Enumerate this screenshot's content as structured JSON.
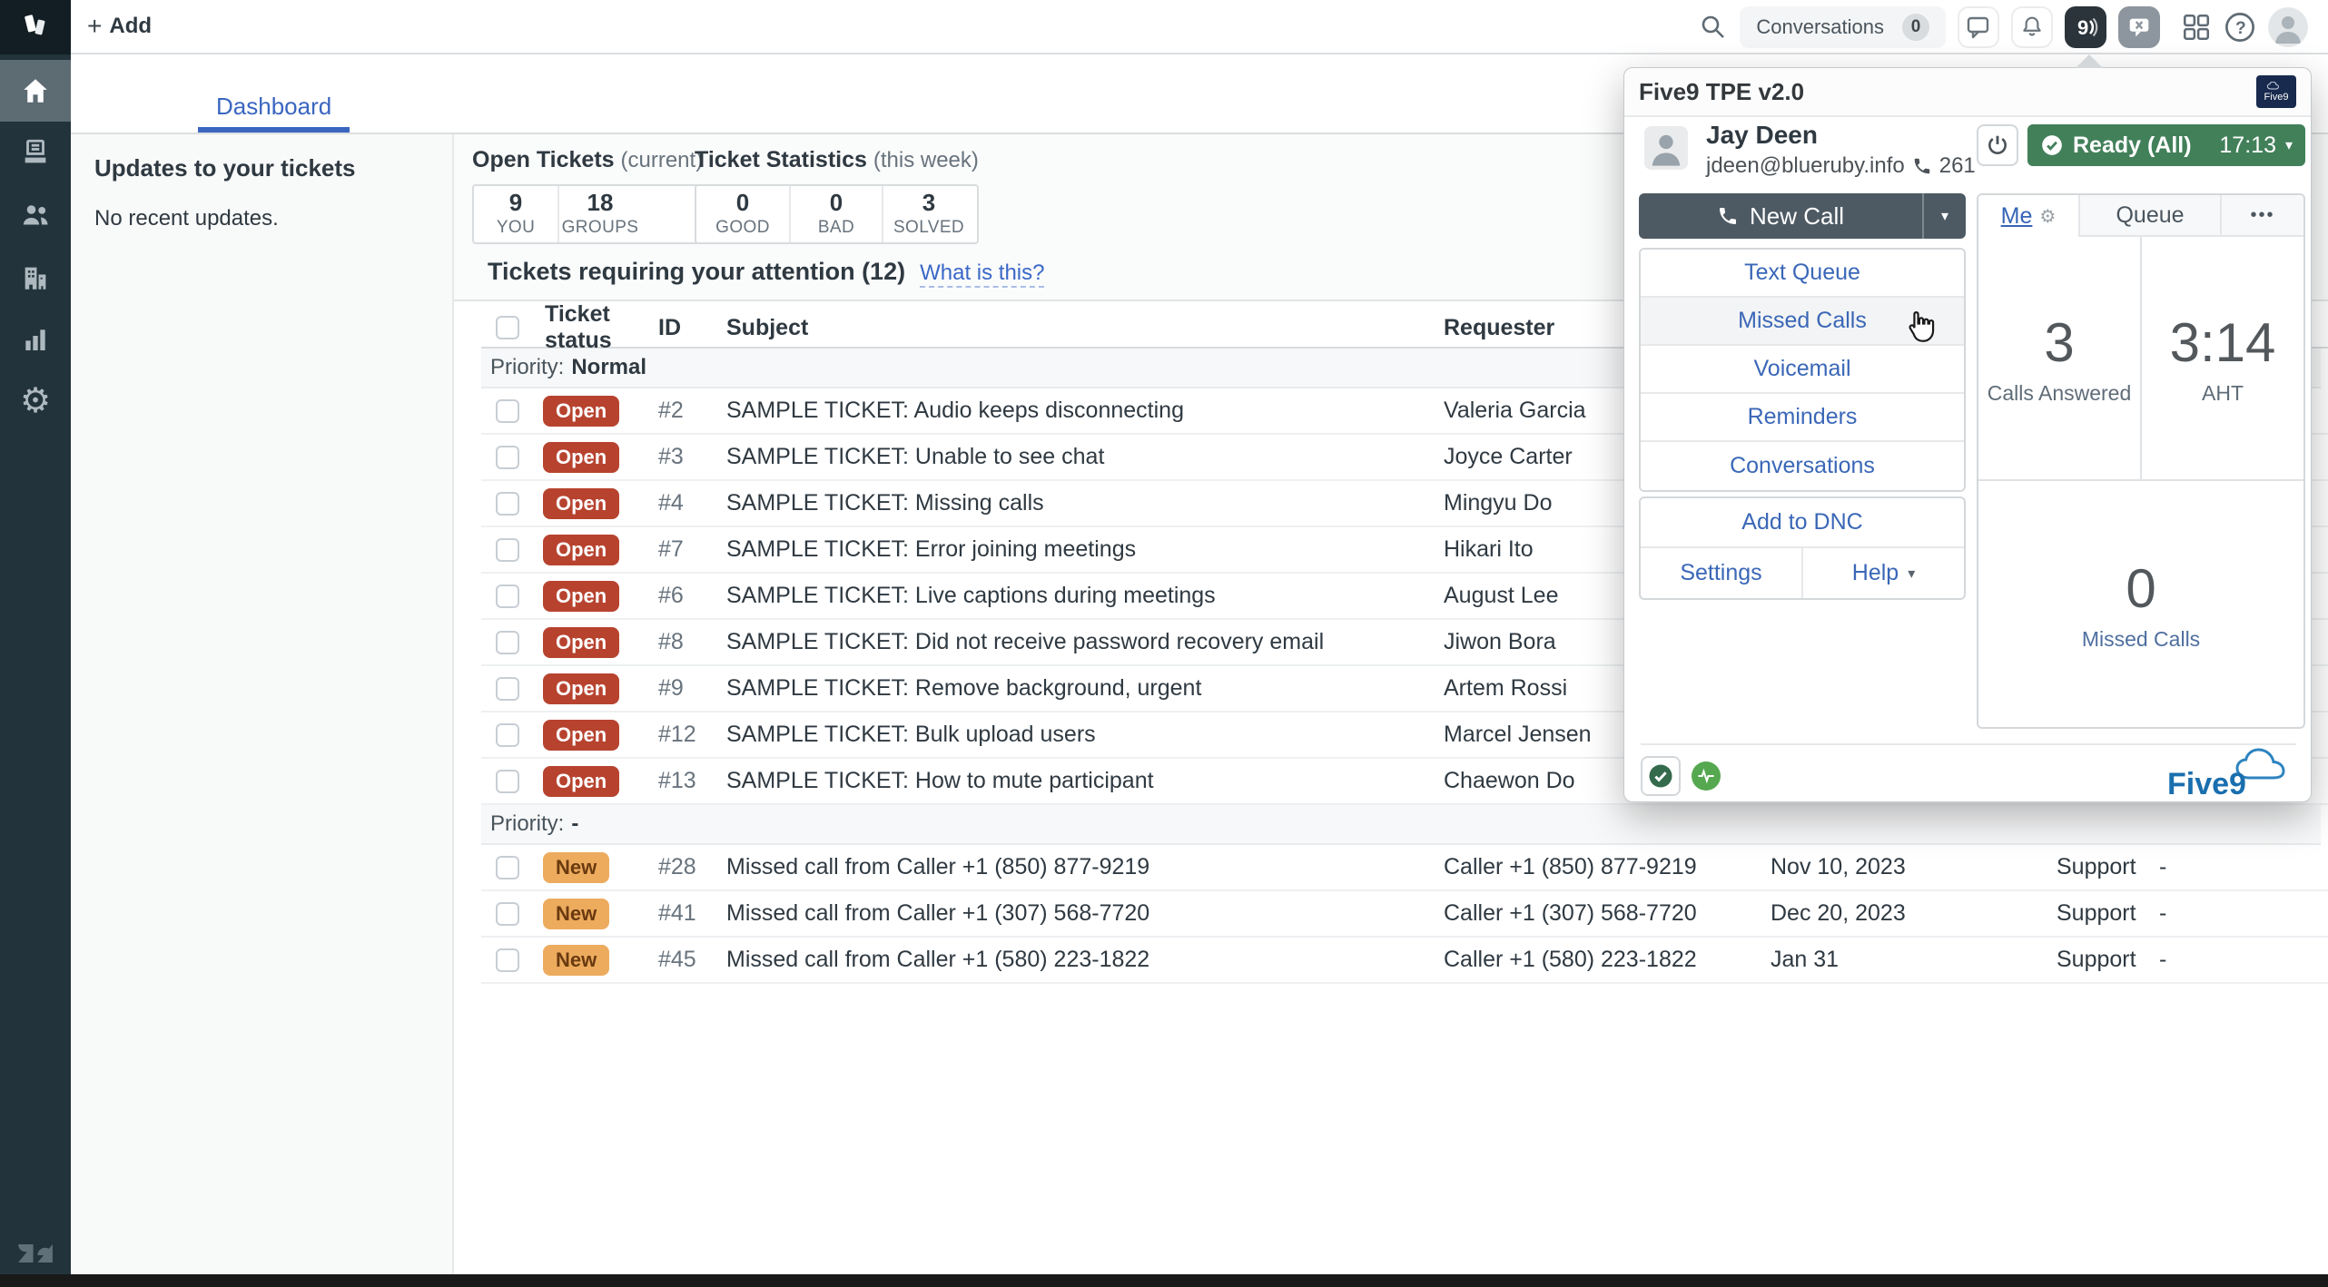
{
  "topnav": {
    "add_label": "Add",
    "conversations_label": "Conversations",
    "conversations_count": "0"
  },
  "tabs": {
    "dashboard": "Dashboard"
  },
  "updates": {
    "title": "Updates to your tickets",
    "empty": "No recent updates."
  },
  "stats": {
    "open": {
      "title": "Open Tickets",
      "subtitle": "(current)",
      "cells": [
        {
          "value": "9",
          "label": "YOU"
        },
        {
          "value": "18",
          "label": "GROUPS"
        }
      ]
    },
    "week": {
      "title": "Ticket Statistics",
      "subtitle": "(this week)",
      "cells": [
        {
          "value": "0",
          "label": "GOOD"
        },
        {
          "value": "0",
          "label": "BAD"
        },
        {
          "value": "3",
          "label": "SOLVED"
        }
      ]
    }
  },
  "attention": {
    "title": "Tickets requiring your attention (12)",
    "link": "What is this?"
  },
  "table": {
    "headers": {
      "status": "Ticket status",
      "id": "ID",
      "subject": "Subject",
      "requester": "Requester"
    },
    "groups": [
      {
        "prefix": "Priority:",
        "value": "Normal",
        "rows": [
          {
            "status": "Open",
            "id": "#2",
            "subject": "SAMPLE TICKET: Audio keeps disconnecting",
            "requester": "Valeria Garcia"
          },
          {
            "status": "Open",
            "id": "#3",
            "subject": "SAMPLE TICKET: Unable to see chat",
            "requester": "Joyce Carter"
          },
          {
            "status": "Open",
            "id": "#4",
            "subject": "SAMPLE TICKET: Missing calls",
            "requester": "Mingyu Do"
          },
          {
            "status": "Open",
            "id": "#7",
            "subject": "SAMPLE TICKET: Error joining meetings",
            "requester": "Hikari Ito"
          },
          {
            "status": "Open",
            "id": "#6",
            "subject": "SAMPLE TICKET: Live captions during meetings",
            "requester": "August Lee"
          },
          {
            "status": "Open",
            "id": "#8",
            "subject": "SAMPLE TICKET: Did not receive password recovery email",
            "requester": "Jiwon Bora"
          },
          {
            "status": "Open",
            "id": "#9",
            "subject": "SAMPLE TICKET: Remove background, urgent",
            "requester": "Artem Rossi"
          },
          {
            "status": "Open",
            "id": "#12",
            "subject": "SAMPLE TICKET: Bulk upload users",
            "requester": "Marcel Jensen"
          },
          {
            "status": "Open",
            "id": "#13",
            "subject": "SAMPLE TICKET: How to mute participant",
            "requester": "Chaewon Do"
          }
        ]
      },
      {
        "prefix": "Priority:",
        "value": "-",
        "rows": [
          {
            "status": "New",
            "id": "#28",
            "subject": "Missed call from Caller +1 (850) 877-9219",
            "requester": "Caller +1 (850) 877-9219",
            "requested": "Nov 10, 2023",
            "group": "Support",
            "assignee": "-"
          },
          {
            "status": "New",
            "id": "#41",
            "subject": "Missed call from Caller +1 (307) 568-7720",
            "requester": "Caller +1 (307) 568-7720",
            "requested": "Dec 20, 2023",
            "group": "Support",
            "assignee": "-"
          },
          {
            "status": "New",
            "id": "#45",
            "subject": "Missed call from Caller +1 (580) 223-1822",
            "requester": "Caller +1 (580) 223-1822",
            "requested": "Jan 31",
            "group": "Support",
            "assignee": "-"
          }
        ]
      }
    ]
  },
  "five9": {
    "title": "Five9 TPE v2.0",
    "badge": "Five9",
    "user": {
      "name": "Jay Deen",
      "email": "jdeen@blueruby.info",
      "extension": "261"
    },
    "status": {
      "label": "Ready (All)",
      "timer": "17:13"
    },
    "new_call": "New Call",
    "menu": [
      "Text Queue",
      "Missed Calls",
      "Voicemail",
      "Reminders",
      "Conversations"
    ],
    "dnc": "Add to DNC",
    "settings": "Settings",
    "help": "Help",
    "tabs": {
      "me": "Me",
      "queue": "Queue",
      "more": "•••"
    },
    "stats": {
      "answered": {
        "value": "3",
        "label": "Calls Answered"
      },
      "aht": {
        "value": "3:14",
        "label": "AHT"
      },
      "missed": {
        "value": "0",
        "label": "Missed Calls"
      }
    },
    "brand": "Five9"
  },
  "colors": {
    "sidebar": "#22333c",
    "active_nav": "#5d6b73",
    "tab_blue": "#3a66c0",
    "link_blue": "#3a68c7",
    "open_badge": "#b7432f",
    "new_badge_bg": "#edab5e",
    "new_badge_text": "#6a3a10",
    "ready_green": "#42805a",
    "newcall_slate": "#4d5a64",
    "five9_link_blue": "#3a67b7"
  }
}
